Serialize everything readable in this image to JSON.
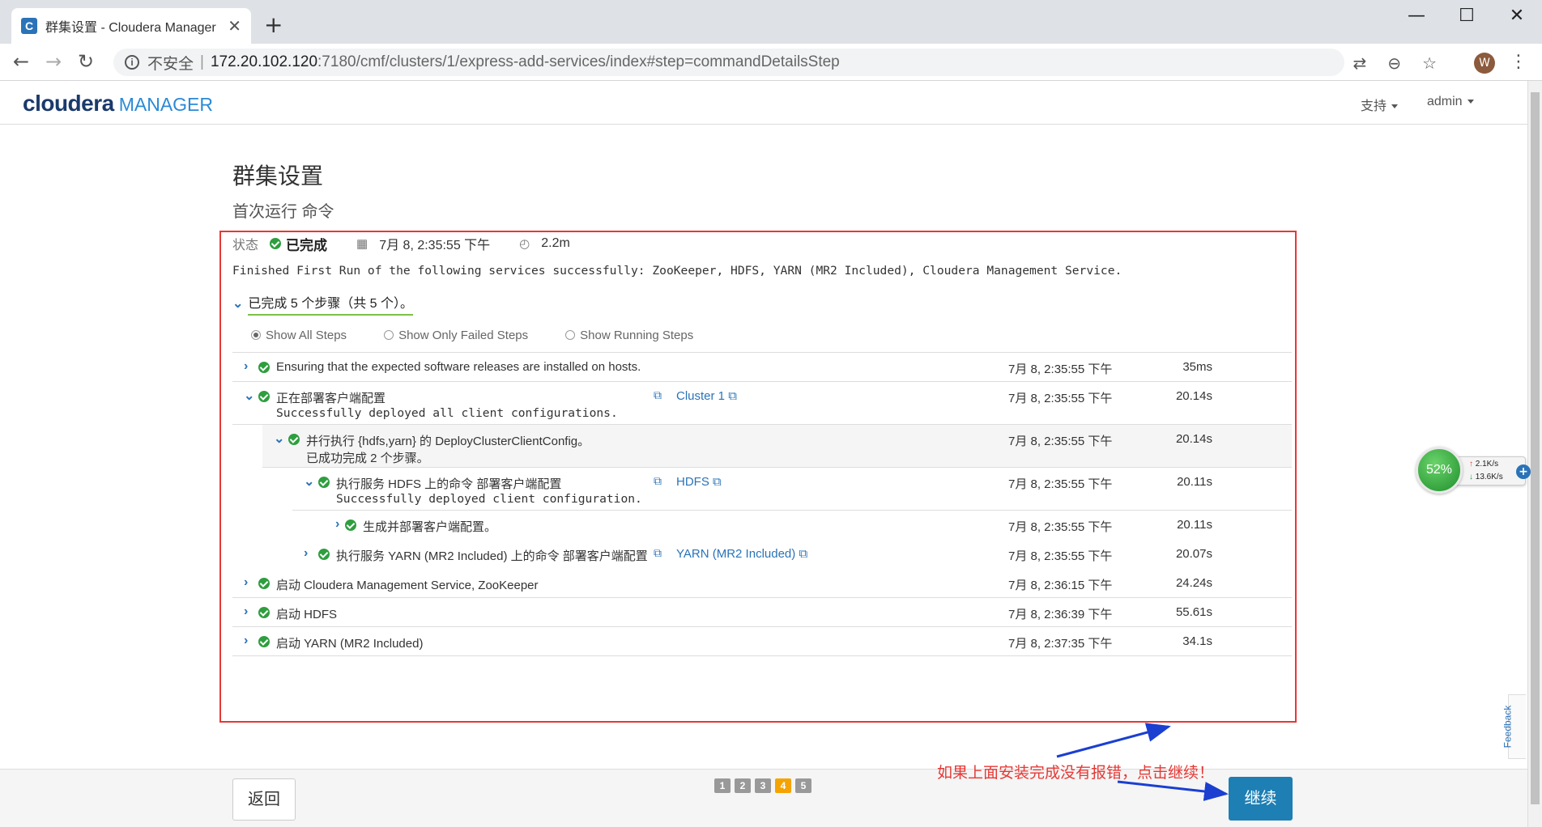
{
  "browser": {
    "tab_title": "群集设置 - Cloudera Manager",
    "tab_close": "✕",
    "new_tab": "+",
    "favicon": "C",
    "address": {
      "info_icon": "i",
      "insecure_label": "不安全",
      "separator": "|",
      "host": "172.20.102.120",
      "path": ":7180/cmf/clusters/1/express-add-services/index#step=commandDetailsStep"
    },
    "avatar_initial": "W"
  },
  "header": {
    "logo_brand": "cloudera",
    "logo_product": "MANAGER",
    "menu_support": "支持",
    "menu_user": "admin"
  },
  "page": {
    "title": "群集设置",
    "subtitle": "首次运行 命令"
  },
  "status": {
    "label": "状态",
    "state": "已完成",
    "datetime": "7月 8, 2:35:55 下午",
    "duration": "2.2m",
    "message": "Finished First Run of the following services successfully: ZooKeeper, HDFS, YARN (MR2 Included), Cloudera Management Service.",
    "steps_summary": "已完成 5 个步骤（共 5 个）。"
  },
  "filters": {
    "all": "Show All Steps",
    "failed": "Show Only Failed Steps",
    "running": "Show Running Steps",
    "selected": "all"
  },
  "steps": [
    {
      "name": "Ensuring that the expected software releases are installed on hosts.",
      "time": "7月 8, 2:35:55 下午",
      "duration": "35ms"
    },
    {
      "name": "正在部署客户端配置",
      "detail": "Successfully deployed all client configurations.",
      "link": "Cluster 1",
      "time": "7月 8, 2:35:55 下午",
      "duration": "20.14s"
    },
    {
      "name": "并行执行 {hdfs,yarn} 的 DeployClusterClientConfig。",
      "detail": "已成功完成 2 个步骤。",
      "time": "7月 8, 2:35:55 下午",
      "duration": "20.14s"
    },
    {
      "name": "执行服务 HDFS 上的命令 部署客户端配置",
      "detail": "Successfully deployed client configuration.",
      "link": "HDFS",
      "time": "7月 8, 2:35:55 下午",
      "duration": "20.11s"
    },
    {
      "name": "生成并部署客户端配置。",
      "time": "7月 8, 2:35:55 下午",
      "duration": "20.11s"
    },
    {
      "name": "执行服务 YARN (MR2 Included) 上的命令 部署客户端配置",
      "link": "YARN (MR2 Included)",
      "time": "7月 8, 2:35:55 下午",
      "duration": "20.07s"
    },
    {
      "name": "启动 Cloudera Management Service, ZooKeeper",
      "time": "7月 8, 2:36:15 下午",
      "duration": "24.24s"
    },
    {
      "name": "启动 HDFS",
      "time": "7月 8, 2:36:39 下午",
      "duration": "55.61s"
    },
    {
      "name": "启动 YARN (MR2 Included)",
      "time": "7月 8, 2:37:35 下午",
      "duration": "34.1s"
    }
  ],
  "footer": {
    "back": "返回",
    "continue": "继续",
    "pages": [
      "1",
      "2",
      "3",
      "4",
      "5"
    ],
    "current_page": "4"
  },
  "annotation": "如果上面安装完成没有报错，点击继续！",
  "net_monitor": {
    "percent": "52%",
    "up": "2.1K/s",
    "down": "13.6K/s",
    "up_arrow": "↑",
    "down_arrow": "↓",
    "plus": "+"
  },
  "feedback": "Feedback",
  "colors": {
    "annotation_red": "#e53935",
    "success_green": "#2e9e3e",
    "link_blue": "#2a73b8",
    "continue_blue": "#1d7fb4",
    "active_page": "#f5a300"
  }
}
